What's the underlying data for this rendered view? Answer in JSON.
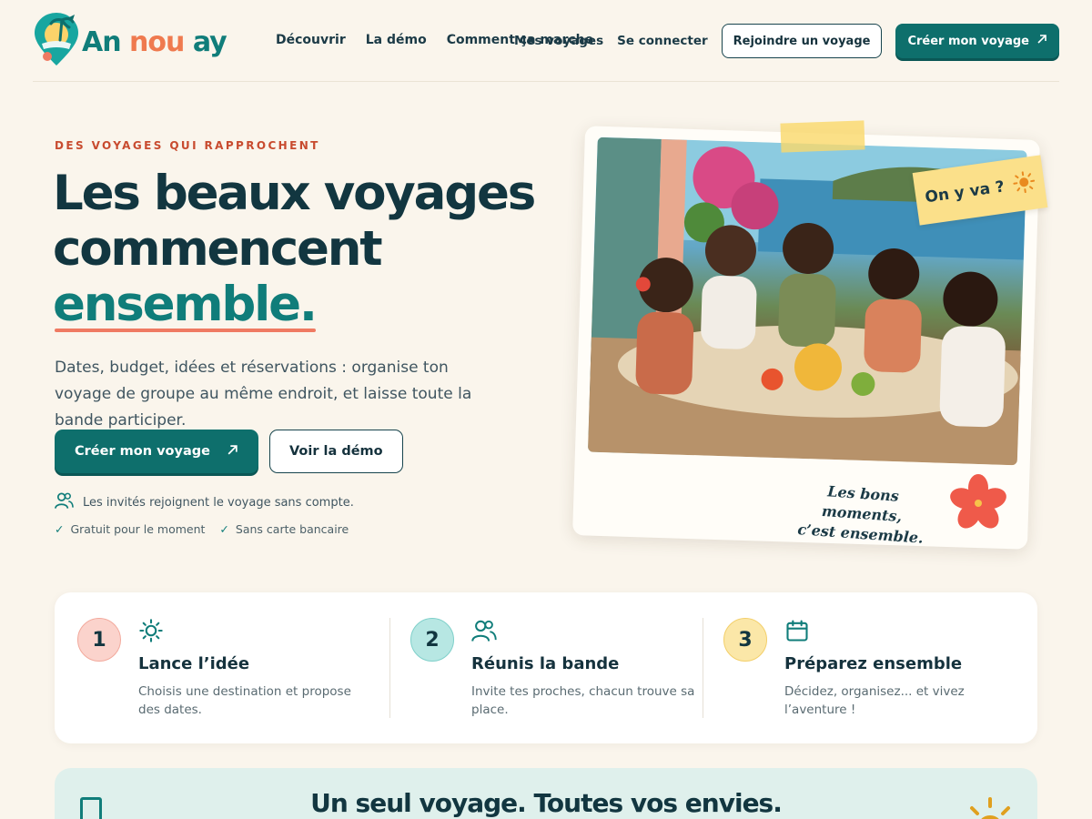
{
  "brand": {
    "name_part1": "An",
    "name_part2": "nou",
    "name_part3": "ay"
  },
  "nav": {
    "links": [
      "Découvrir",
      "La démo",
      "Comment ça marche"
    ],
    "my_trips": "Mes voyages",
    "login": "Se connecter",
    "join_trip": "Rejoindre un voyage",
    "create_trip": "Créer mon voyage"
  },
  "hero": {
    "eyebrow": "DES VOYAGES QUI RAPPROCHENT",
    "title_line1": "Les beaux voyages",
    "title_line2": "commencent",
    "title_accent": "ensemble.",
    "subtitle": "Dates, budget, idées et réservations : organise ton voyage de groupe au même endroit, et laisse toute la bande participer.",
    "cta_primary": "Créer mon voyage",
    "cta_secondary": "Voir la démo",
    "reassurance": "Les invités rejoignent le voyage sans compte.",
    "check1": "Gratuit pour le moment",
    "check2": "Sans carte bancaire"
  },
  "photo_card": {
    "sticky_note": "On y va ?",
    "caption_line1": "Les bons moments,",
    "caption_line2": "c’est ensemble."
  },
  "steps": [
    {
      "number": "1",
      "icon": "sun-icon",
      "title": "Lance l’idée",
      "desc": "Choisis une destination et propose des dates."
    },
    {
      "number": "2",
      "icon": "group-icon",
      "title": "Réunis la bande",
      "desc": "Invite tes proches, chacun trouve sa place."
    },
    {
      "number": "3",
      "icon": "calendar-icon",
      "title": "Préparez ensemble",
      "desc": "Décidez, organisez... et vivez l’aventure !"
    }
  ],
  "band": {
    "title": "Un seul voyage. Toutes vos envies."
  },
  "colors": {
    "teal": "#0e6f6c",
    "coral": "#ef7a62",
    "background": "#faf5ec",
    "step1": "#fbd3cc",
    "step2": "#b7e7e3",
    "step3": "#fbe7a8"
  }
}
